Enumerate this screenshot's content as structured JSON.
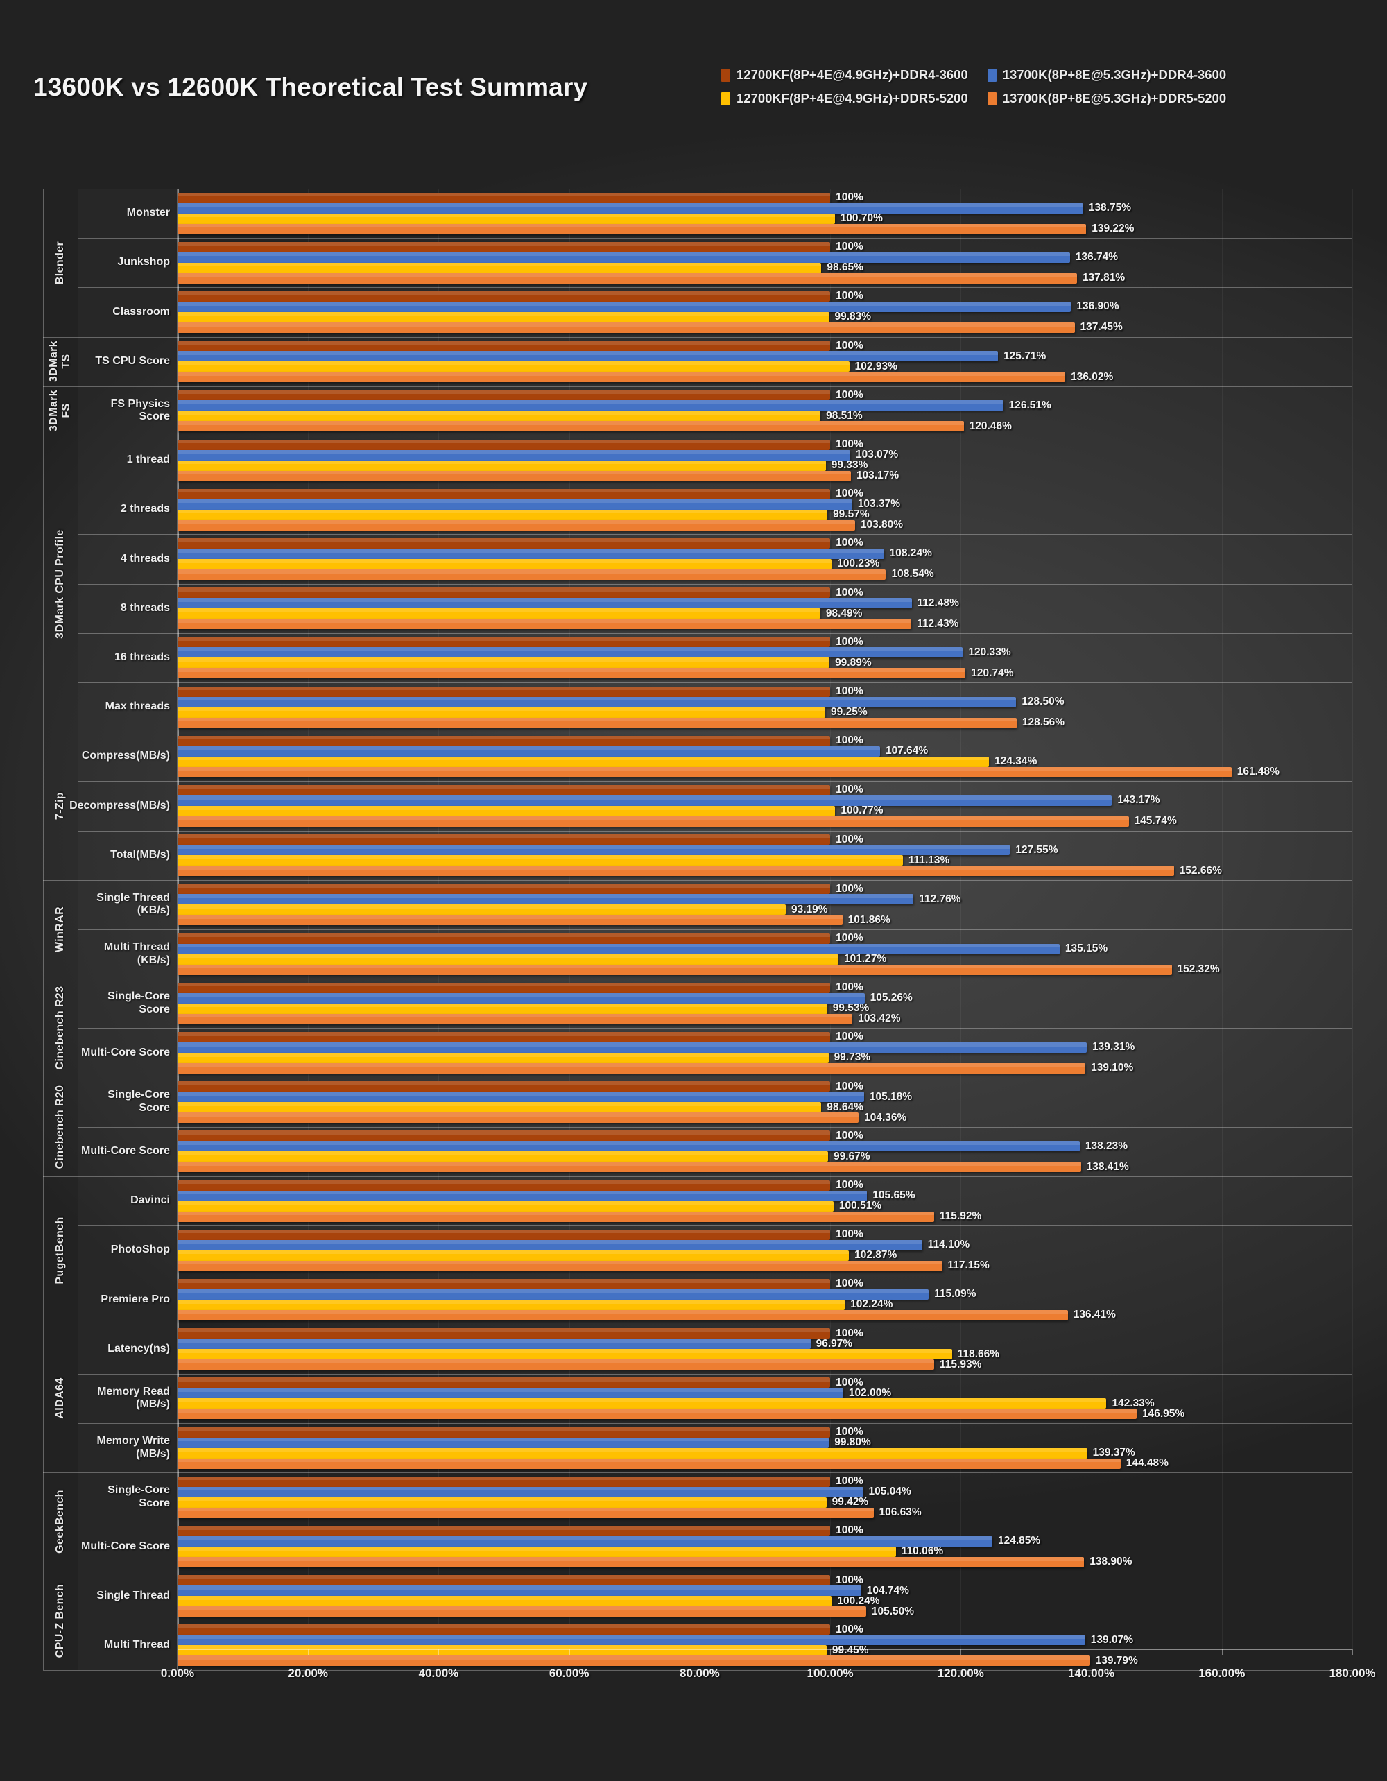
{
  "title": "13600K vs 12600K Theoretical Test Summary",
  "legend": {
    "items": [
      {
        "label": "12700KF(8P+4E@4.9GHz)+DDR4-3600",
        "color": "#A8430B"
      },
      {
        "label": "13700K(8P+8E@5.3GHz)+DDR4-3600",
        "color": "#4472C4"
      },
      {
        "label": "12700KF(8P+4E@4.9GHz)+DDR5-5200",
        "color": "#FFC000"
      },
      {
        "label": "13700K(8P+8E@5.3GHz)+DDR5-5200",
        "color": "#ED7D31"
      }
    ]
  },
  "chart_data": {
    "type": "bar",
    "orientation": "horizontal",
    "title": "13600K vs 12600K Theoretical Test Summary",
    "xlabel": "",
    "ylabel": "",
    "xlim": [
      0,
      180
    ],
    "xtick_labels": [
      "0.00%",
      "20.00%",
      "40.00%",
      "60.00%",
      "80.00%",
      "100.00%",
      "120.00%",
      "140.00%",
      "160.00%",
      "180.00%"
    ],
    "xticks": [
      0,
      20,
      40,
      60,
      80,
      100,
      120,
      140,
      160,
      180
    ],
    "grid": true,
    "legend_position": "top-right",
    "series": [
      {
        "name": "12700KF(8P+4E@4.9GHz)+DDR4-3600",
        "color": "#A8430B"
      },
      {
        "name": "13700K(8P+8E@5.3GHz)+DDR4-3600",
        "color": "#4472C4"
      },
      {
        "name": "12700KF(8P+4E@4.9GHz)+DDR5-5200",
        "color": "#FFC000"
      },
      {
        "name": "13700K(8P+8E@5.3GHz)+DDR5-5200",
        "color": "#ED7D31"
      }
    ],
    "groups": [
      {
        "group": "Blender",
        "rows": [
          {
            "item": "Monster",
            "values": [
              100,
              138.75,
              100.7,
              139.22
            ],
            "labels": [
              "100%",
              "138.75%",
              "100.70%",
              "139.22%"
            ]
          },
          {
            "item": "Junkshop",
            "values": [
              100,
              136.74,
              98.65,
              137.81
            ],
            "labels": [
              "100%",
              "136.74%",
              "98.65%",
              "137.81%"
            ]
          },
          {
            "item": "Classroom",
            "values": [
              100,
              136.9,
              99.83,
              137.45
            ],
            "labels": [
              "100%",
              "136.90%",
              "99.83%",
              "137.45%"
            ]
          }
        ]
      },
      {
        "group": "3DMark\nTS",
        "rows": [
          {
            "item": "TS CPU Score",
            "values": [
              100,
              125.71,
              102.93,
              136.02
            ],
            "labels": [
              "100%",
              "125.71%",
              "102.93%",
              "136.02%"
            ]
          }
        ]
      },
      {
        "group": "3DMark\nFS",
        "rows": [
          {
            "item": "FS Physics Score",
            "values": [
              100,
              126.51,
              98.51,
              120.46
            ],
            "labels": [
              "100%",
              "126.51%",
              "98.51%",
              "120.46%"
            ]
          }
        ]
      },
      {
        "group": "3DMark CPU Profile",
        "rows": [
          {
            "item": "1 thread",
            "values": [
              100,
              103.07,
              99.33,
              103.17
            ],
            "labels": [
              "100%",
              "103.07%",
              "99.33%",
              "103.17%"
            ]
          },
          {
            "item": "2 threads",
            "values": [
              100,
              103.37,
              99.57,
              103.8
            ],
            "labels": [
              "100%",
              "103.37%",
              "99.57%",
              "103.80%"
            ]
          },
          {
            "item": "4 threads",
            "values": [
              100,
              108.24,
              100.23,
              108.54
            ],
            "labels": [
              "100%",
              "108.24%",
              "100.23%",
              "108.54%"
            ]
          },
          {
            "item": "8 threads",
            "values": [
              100,
              112.48,
              98.49,
              112.43
            ],
            "labels": [
              "100%",
              "112.48%",
              "98.49%",
              "112.43%"
            ]
          },
          {
            "item": "16 threads",
            "values": [
              100,
              120.33,
              99.89,
              120.74
            ],
            "labels": [
              "100%",
              "120.33%",
              "99.89%",
              "120.74%"
            ]
          },
          {
            "item": "Max threads",
            "values": [
              100,
              128.5,
              99.25,
              128.56
            ],
            "labels": [
              "100%",
              "128.50%",
              "99.25%",
              "128.56%"
            ]
          }
        ]
      },
      {
        "group": "7-Zip",
        "rows": [
          {
            "item": "Compress(MB/s)",
            "values": [
              100,
              107.64,
              124.34,
              161.48
            ],
            "labels": [
              "100%",
              "107.64%",
              "124.34%",
              "161.48%"
            ]
          },
          {
            "item": "Decompress(MB/s)",
            "values": [
              100,
              143.17,
              100.77,
              145.74
            ],
            "labels": [
              "100%",
              "143.17%",
              "100.77%",
              "145.74%"
            ]
          },
          {
            "item": "Total(MB/s)",
            "values": [
              100,
              127.55,
              111.13,
              152.66
            ],
            "labels": [
              "100%",
              "127.55%",
              "111.13%",
              "152.66%"
            ]
          }
        ]
      },
      {
        "group": "WinRAR",
        "rows": [
          {
            "item": "Single Thread\n(KB/s)",
            "values": [
              100,
              112.76,
              93.19,
              101.86
            ],
            "labels": [
              "100%",
              "112.76%",
              "93.19%",
              "101.86%"
            ]
          },
          {
            "item": "Multi Thread\n(KB/s)",
            "values": [
              100,
              135.15,
              101.27,
              152.32
            ],
            "labels": [
              "100%",
              "135.15%",
              "101.27%",
              "152.32%"
            ]
          }
        ]
      },
      {
        "group": "Cinebench R23",
        "rows": [
          {
            "item": "Single-Core Score",
            "values": [
              100,
              105.26,
              99.53,
              103.42
            ],
            "labels": [
              "100%",
              "105.26%",
              "99.53%",
              "103.42%"
            ]
          },
          {
            "item": "Multi-Core Score",
            "values": [
              100,
              139.31,
              99.73,
              139.1
            ],
            "labels": [
              "100%",
              "139.31%",
              "99.73%",
              "139.10%"
            ]
          }
        ]
      },
      {
        "group": "Cinebench R20",
        "rows": [
          {
            "item": "Single-Core Score",
            "values": [
              100,
              105.18,
              98.64,
              104.36
            ],
            "labels": [
              "100%",
              "105.18%",
              "98.64%",
              "104.36%"
            ]
          },
          {
            "item": "Multi-Core Score",
            "values": [
              100,
              138.23,
              99.67,
              138.41
            ],
            "labels": [
              "100%",
              "138.23%",
              "99.67%",
              "138.41%"
            ]
          }
        ]
      },
      {
        "group": "PugetBench",
        "rows": [
          {
            "item": "Davinci",
            "values": [
              100,
              105.65,
              100.51,
              115.92
            ],
            "labels": [
              "100%",
              "105.65%",
              "100.51%",
              "115.92%"
            ]
          },
          {
            "item": "PhotoShop",
            "values": [
              100,
              114.1,
              102.87,
              117.15
            ],
            "labels": [
              "100%",
              "114.10%",
              "102.87%",
              "117.15%"
            ]
          },
          {
            "item": "Premiere Pro",
            "values": [
              100,
              115.09,
              102.24,
              136.41
            ],
            "labels": [
              "100%",
              "115.09%",
              "102.24%",
              "136.41%"
            ]
          }
        ]
      },
      {
        "group": "AIDA64",
        "rows": [
          {
            "item": "Latency(ns)",
            "values": [
              100,
              96.97,
              118.66,
              115.93
            ],
            "labels": [
              "100%",
              "96.97%",
              "118.66%",
              "115.93%"
            ]
          },
          {
            "item": "Memory Read\n(MB/s)",
            "values": [
              100,
              102.0,
              142.33,
              146.95
            ],
            "labels": [
              "100%",
              "102.00%",
              "142.33%",
              "146.95%"
            ]
          },
          {
            "item": "Memory Write\n(MB/s)",
            "values": [
              100,
              99.8,
              139.37,
              144.48
            ],
            "labels": [
              "100%",
              "99.80%",
              "139.37%",
              "144.48%"
            ]
          }
        ]
      },
      {
        "group": "GeekBench",
        "rows": [
          {
            "item": "Single-Core Score",
            "values": [
              100,
              105.04,
              99.42,
              106.63
            ],
            "labels": [
              "100%",
              "105.04%",
              "99.42%",
              "106.63%"
            ]
          },
          {
            "item": "Multi-Core Score",
            "values": [
              100,
              124.85,
              110.06,
              138.9
            ],
            "labels": [
              "100%",
              "124.85%",
              "110.06%",
              "138.90%"
            ]
          }
        ]
      },
      {
        "group": "CPU-Z Bench",
        "rows": [
          {
            "item": "Single Thread",
            "values": [
              100,
              104.74,
              100.24,
              105.5
            ],
            "labels": [
              "100%",
              "104.74%",
              "100.24%",
              "105.50%"
            ]
          },
          {
            "item": "Multi Thread",
            "values": [
              100,
              139.07,
              99.45,
              139.79
            ],
            "labels": [
              "100%",
              "139.07%",
              "99.45%",
              "139.79%"
            ]
          }
        ]
      }
    ]
  }
}
